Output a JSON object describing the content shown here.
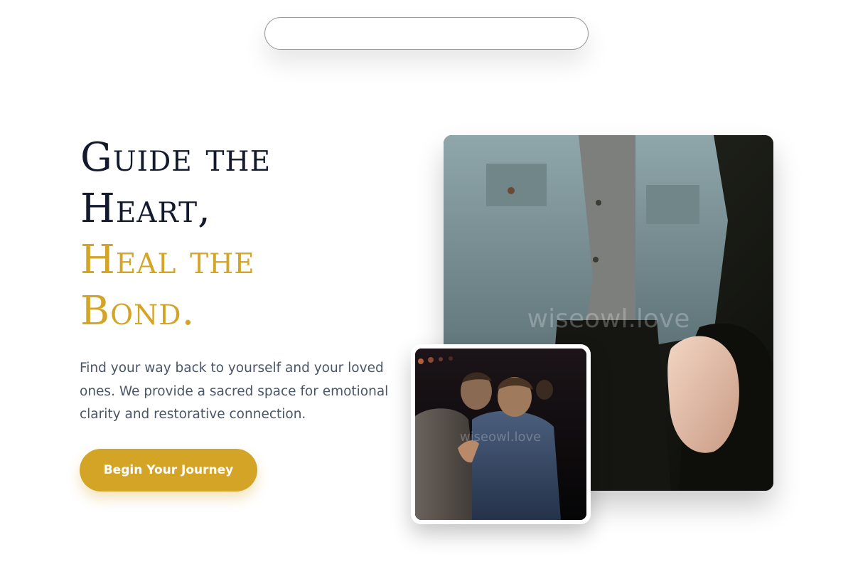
{
  "hero": {
    "heading_line1": "Guide the",
    "heading_line2": "Heart,",
    "heading_line3": "Heal the",
    "heading_line4": "Bond.",
    "description": "Find your way back to yourself and your loved ones. We provide a sacred space for emotional clarity and restorative connection.",
    "cta_label": "Begin Your Journey"
  },
  "images": {
    "large_watermark": "wiseowl.love",
    "small_watermark": "wiseowl.love"
  },
  "colors": {
    "accent": "#d4a427",
    "heading_dark": "#141a2e",
    "body_text": "#4a5568"
  }
}
